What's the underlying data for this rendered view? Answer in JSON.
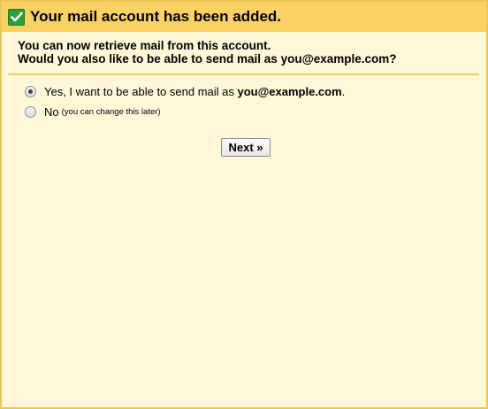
{
  "header": {
    "title": "Your mail account has been added.",
    "icon": "checkmark-icon",
    "background": "#fad163",
    "icon_color": "#2c9e3c"
  },
  "intro": {
    "line1": "You can now retrieve mail from this account.",
    "line2": "Would you also like to be able to send mail as you@example.com?"
  },
  "options": [
    {
      "label": "Yes, I want to be able to send mail as ",
      "email": "you@example.com",
      "suffix": ".",
      "selected": true
    },
    {
      "label": "No",
      "note": "(you can change this later)",
      "selected": false
    }
  ],
  "buttons": {
    "next": "Next »"
  },
  "colors": {
    "panel_background": "#fff7d7",
    "border": "#e9c755"
  }
}
